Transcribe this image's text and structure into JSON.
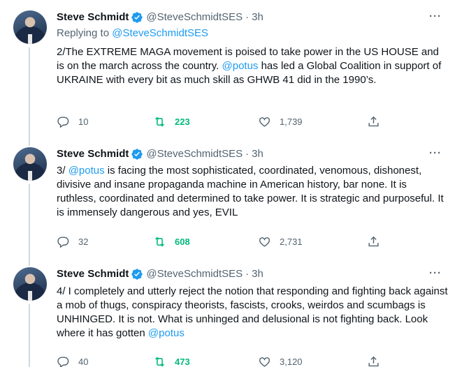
{
  "colors": {
    "link": "#1d9bf0",
    "retweeted": "#00ba7c",
    "muted": "#536471",
    "verified": "#1d9bf0"
  },
  "tweets": [
    {
      "author_name": "Steve Schmidt",
      "handle": "@SteveSchmidtSES",
      "separator": "·",
      "time": "3h",
      "replying_prefix": "Replying to",
      "replying_handle": "@SteveSchmidtSES",
      "text_before": "2/The EXTREME MAGA movement is poised to take power in the US HOUSE and is on the march across the country.",
      "mention": "@potus",
      "text_after": "has led a Global Coalition in support of UKRAINE with every bit as much skill as GHWB 41 did in the 1990’s.",
      "replies": "10",
      "retweets": "223",
      "likes": "1,739",
      "icons": [
        "reply-icon",
        "retweet-icon",
        "like-icon",
        "share-icon",
        "more-icon",
        "verified-icon"
      ]
    },
    {
      "author_name": "Steve Schmidt",
      "handle": "@SteveSchmidtSES",
      "separator": "·",
      "time": "3h",
      "text_prefix": "3/",
      "mention": "@potus",
      "text_after": "is facing the most sophisticated, coordinated, venomous, dishonest, divisive and insane propaganda machine in American history, bar none. It is ruthless, coordinated and determined to take power. It is strategic and purposeful. It is immensely dangerous and yes, EVIL",
      "replies": "32",
      "retweets": "608",
      "likes": "2,731"
    },
    {
      "author_name": "Steve Schmidt",
      "handle": "@SteveSchmidtSES",
      "separator": "·",
      "time": "3h",
      "text_before": "4/ I completely and utterly reject the notion that responding and fighting back against a mob of thugs, conspiracy theorists, fascists, crooks, weirdos and scumbags is UNHINGED. It is not. What is unhinged and delusional is not fighting back. Look where it has gotten",
      "mention": "@potus",
      "replies": "40",
      "retweets": "473",
      "likes": "3,120"
    }
  ]
}
